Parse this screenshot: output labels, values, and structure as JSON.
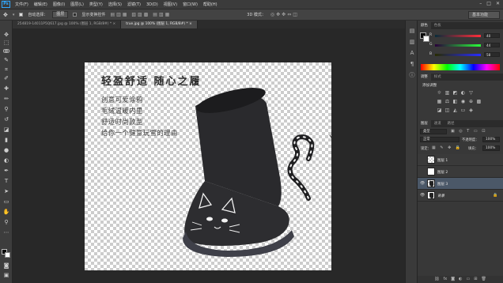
{
  "app": {
    "logo": "Ps"
  },
  "menu": [
    "文件(F)",
    "编辑(E)",
    "图像(I)",
    "图层(L)",
    "类型(Y)",
    "选择(S)",
    "滤镜(T)",
    "3D(D)",
    "视图(V)",
    "窗口(W)",
    "帮助(H)"
  ],
  "window_controls": [
    "–",
    "□",
    "✕"
  ],
  "options": {
    "auto_select_label": "自动选择：",
    "auto_select_value": "图层",
    "transform_label": "显示变换控件",
    "mode_3d_label": "3D 模式：",
    "workspace": "基本功能"
  },
  "tabs": [
    {
      "label": "254819-14011P5Q617.jpg @ 100% (图层 1, RGB/8#) *  ×"
    },
    {
      "label": "true.jpg @ 100% (图层 1, RGB/8#) *  ×"
    }
  ],
  "canvas": {
    "headline": "轻盈舒适  随心之履",
    "lines": [
      "创意可爱涂鸦",
      "毛绒温暖内里",
      "舒适时尚款型",
      "给你一个健意玩雪的理由"
    ]
  },
  "panel_color": {
    "tab_color": "颜色",
    "tab_swatches": "色板",
    "r_label": "R",
    "g_label": "G",
    "b_label": "B",
    "r_value": "40",
    "g_value": "44",
    "b_value": "58"
  },
  "panel_adjust": {
    "tab_adjust": "调整",
    "tab_styles": "样式",
    "add_label": "添加调整"
  },
  "panel_layers": {
    "tab_layers": "图层",
    "tab_channels": "通道",
    "tab_paths": "路径",
    "filter_type": "类型",
    "blend_mode": "正常",
    "opacity_label": "不透明度：",
    "opacity_value": "100%",
    "lock_label": "锁定：",
    "fill_label": "填充：",
    "fill_value": "100%",
    "layers": [
      {
        "name": "图层 1",
        "thumb": "",
        "eye": ""
      },
      {
        "name": "图层 2",
        "thumb": "",
        "eye": ""
      },
      {
        "name": "图层 3",
        "thumb": "",
        "eye": "👁"
      },
      {
        "name": "背景",
        "thumb": "",
        "eye": "👁"
      }
    ]
  },
  "colors": {
    "accent": "#31a8ff",
    "selected_layer": "#4b5868",
    "boot": "#262629"
  }
}
